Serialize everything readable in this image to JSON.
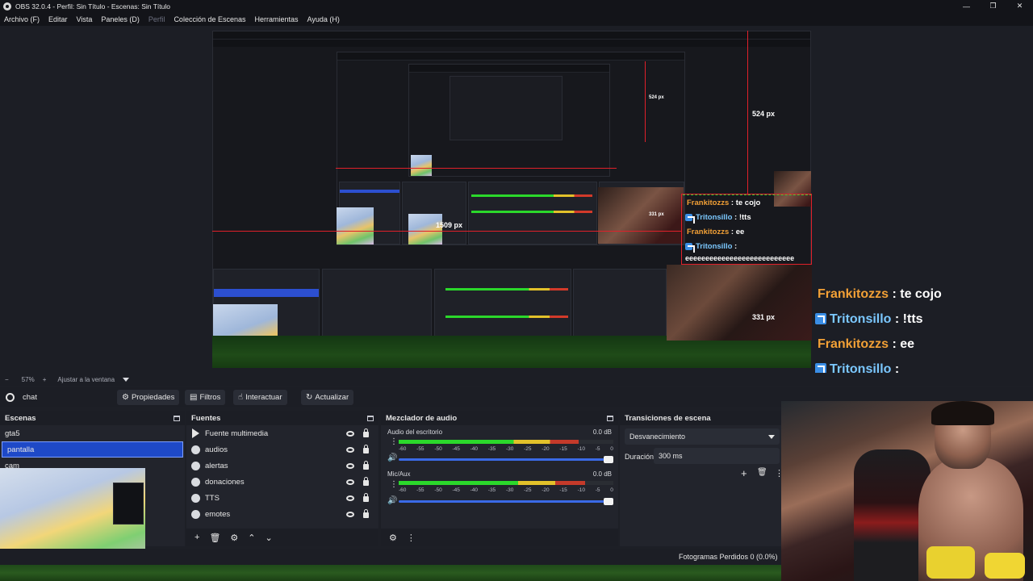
{
  "window": {
    "title": "OBS 32.0.4 - Perfil: Sin Título - Escenas: Sin Título",
    "controls": [
      "—",
      "❐",
      "✕"
    ]
  },
  "menu": {
    "items": [
      "Archivo (F)",
      "Editar",
      "Vista",
      "Paneles (D)",
      "Perfil",
      "Colección de Escenas",
      "Herramientas",
      "Ayuda (H)"
    ]
  },
  "preview": {
    "measure_top": "524 px",
    "measure_center": "1509 px",
    "measure_right": "331 px",
    "nested_measure_top": "524 px",
    "nested_measure_right": "331 px",
    "canvas_chat": [
      {
        "user": "Frankitozzs",
        "msg": " : te cojo",
        "platform": "orange"
      },
      {
        "user": "Tritonsillo",
        "msg": " : !tts",
        "platform": "blue"
      },
      {
        "user": "Frankitozzs",
        "msg": " : ee",
        "platform": "orange"
      },
      {
        "user": "Tritonsillo",
        "msg": " :",
        "platform": "blue"
      },
      {
        "user": "",
        "msg": "eeeeeeeeeeeeeeeeeeeeeeeeeee",
        "platform": "none"
      }
    ]
  },
  "zoom": {
    "percent": "57%",
    "fit_label": "Ajustar a la ventana"
  },
  "source_toolbar": {
    "source_name": "chat",
    "properties": "Propiedades",
    "filters": "Filtros",
    "interact": "Interactuar",
    "refresh": "Actualizar"
  },
  "scenes": {
    "title": "Escenas",
    "items": [
      "gta5",
      "pantalla",
      "cam"
    ],
    "selected": "pantalla"
  },
  "sources": {
    "title": "Fuentes",
    "items": [
      "Fuente multimedia",
      "audios",
      "alertas",
      "donaciones",
      "TTS",
      "emotes"
    ]
  },
  "mixer": {
    "title": "Mezclador de audio",
    "channels": [
      {
        "name": "Audio del escritorio",
        "db": "0.0 dB",
        "level": 0.84
      },
      {
        "name": "Mic/Aux",
        "db": "0.0 dB",
        "level": 0.87
      }
    ],
    "ticks": [
      "-60",
      "-55",
      "-50",
      "-45",
      "-40",
      "-35",
      "-30",
      "-25",
      "-20",
      "-15",
      "-10",
      "-5",
      "0"
    ]
  },
  "transitions": {
    "title": "Transiciones de escena",
    "current": "Desvanecimiento",
    "duration_label": "Duración",
    "duration_value": "300 ms"
  },
  "overlay_chat": [
    {
      "user": "Frankitozzs",
      "msg": " : te cojo",
      "platform": "orange"
    },
    {
      "user": "Tritonsillo",
      "msg": " : !tts",
      "platform": "blue"
    },
    {
      "user": "Frankitozzs",
      "msg": " : ee",
      "platform": "orange"
    },
    {
      "user": "Tritonsillo",
      "msg": " :",
      "platform": "blue"
    },
    {
      "user": "",
      "msg": "eeeeeeeeeeeeeeeeeeeeeeeeeee",
      "platform": "none"
    }
  ],
  "status": {
    "dropped_frames": "Fotogramas Perdidos 0 (0.0%)"
  },
  "colors": {
    "accent_blue": "#1e49c7",
    "guide_red": "#e0202a",
    "chat_orange": "#f2a036",
    "chat_blue": "#7bc8ff"
  }
}
